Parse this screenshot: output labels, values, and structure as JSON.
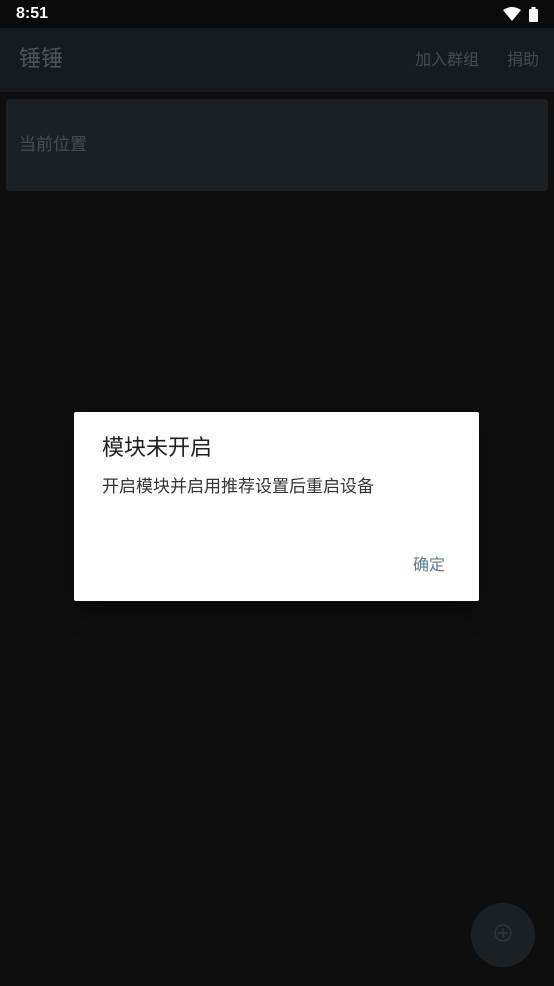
{
  "status_bar": {
    "time": "8:51",
    "icons": [
      "wifi-icon",
      "battery-icon"
    ]
  },
  "app_bar": {
    "title": "锤锤",
    "actions": [
      {
        "label": "加入群组"
      },
      {
        "label": "捐助"
      }
    ]
  },
  "location_card": {
    "label": "当前位置"
  },
  "dialog": {
    "title": "模块未开启",
    "message": "开启模块并启用推荐设置后重启设备",
    "ok_label": "确定"
  },
  "fab": {
    "icon": "add-icon"
  },
  "colors": {
    "background": "#161616",
    "app_bar": "#222a30",
    "card": "#2a3238",
    "dialog_button": "#5b7a8e"
  }
}
